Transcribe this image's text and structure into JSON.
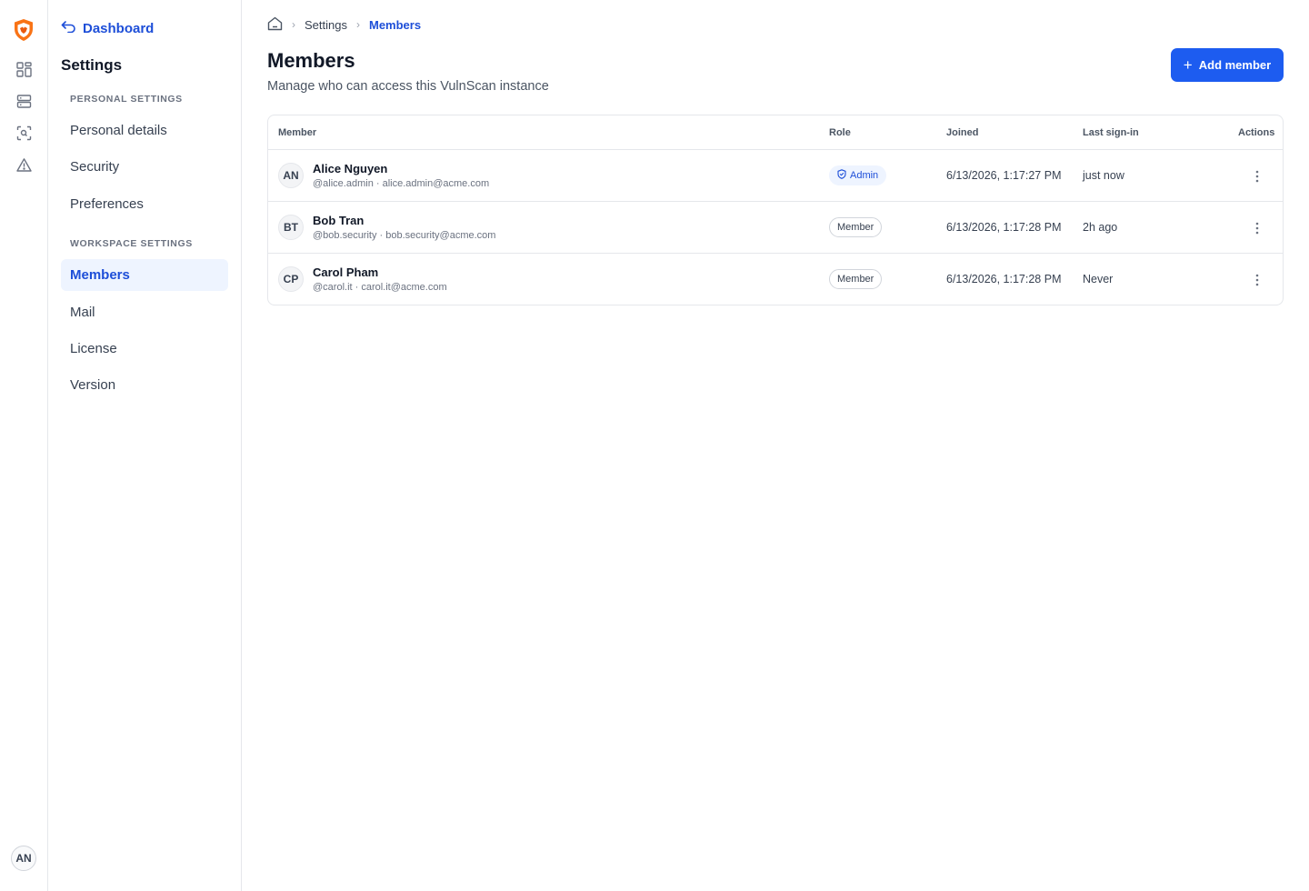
{
  "rail": {
    "brand_color": "#f97316",
    "icons": [
      "dashboard-grid-icon",
      "server-icon",
      "scan-icon",
      "alert-triangle-icon"
    ],
    "user_initials": "AN"
  },
  "sidebar": {
    "back_label": "Dashboard",
    "title": "Settings",
    "personal_section": "PERSONAL SETTINGS",
    "personal_items": [
      "Personal details",
      "Security",
      "Preferences"
    ],
    "workspace_section": "WORKSPACE SETTINGS",
    "workspace_items": [
      "Members",
      "Mail",
      "License",
      "Version"
    ],
    "active_item": "Members"
  },
  "breadcrumb": {
    "home_icon": "home-icon",
    "items": [
      "Settings",
      "Members"
    ]
  },
  "page": {
    "title": "Members",
    "subtitle": "Manage who can access this VulnScan instance",
    "add_button": "Add member"
  },
  "table": {
    "columns": [
      "Member",
      "Role",
      "Joined",
      "Last sign-in",
      "Actions"
    ],
    "rows": [
      {
        "initials": "AN",
        "name": "Alice Nguyen",
        "meta": "@alice.admin · alice.admin@acme.com",
        "role": "Admin",
        "joined": "6/13/2026, 1:17:27 PM",
        "last_sign_in": "just now"
      },
      {
        "initials": "BT",
        "name": "Bob Tran",
        "meta": "@bob.security · bob.security@acme.com",
        "role": "Member",
        "joined": "6/13/2026, 1:17:28 PM",
        "last_sign_in": "2h ago"
      },
      {
        "initials": "CP",
        "name": "Carol Pham",
        "meta": "@carol.it · carol.it@acme.com",
        "role": "Member",
        "joined": "6/13/2026, 1:17:28 PM",
        "last_sign_in": "Never"
      }
    ]
  },
  "colors": {
    "accent": "#1d5cf0",
    "link": "#1d4ed8",
    "active_bg": "#eef4ff",
    "border": "#e5e7eb"
  }
}
